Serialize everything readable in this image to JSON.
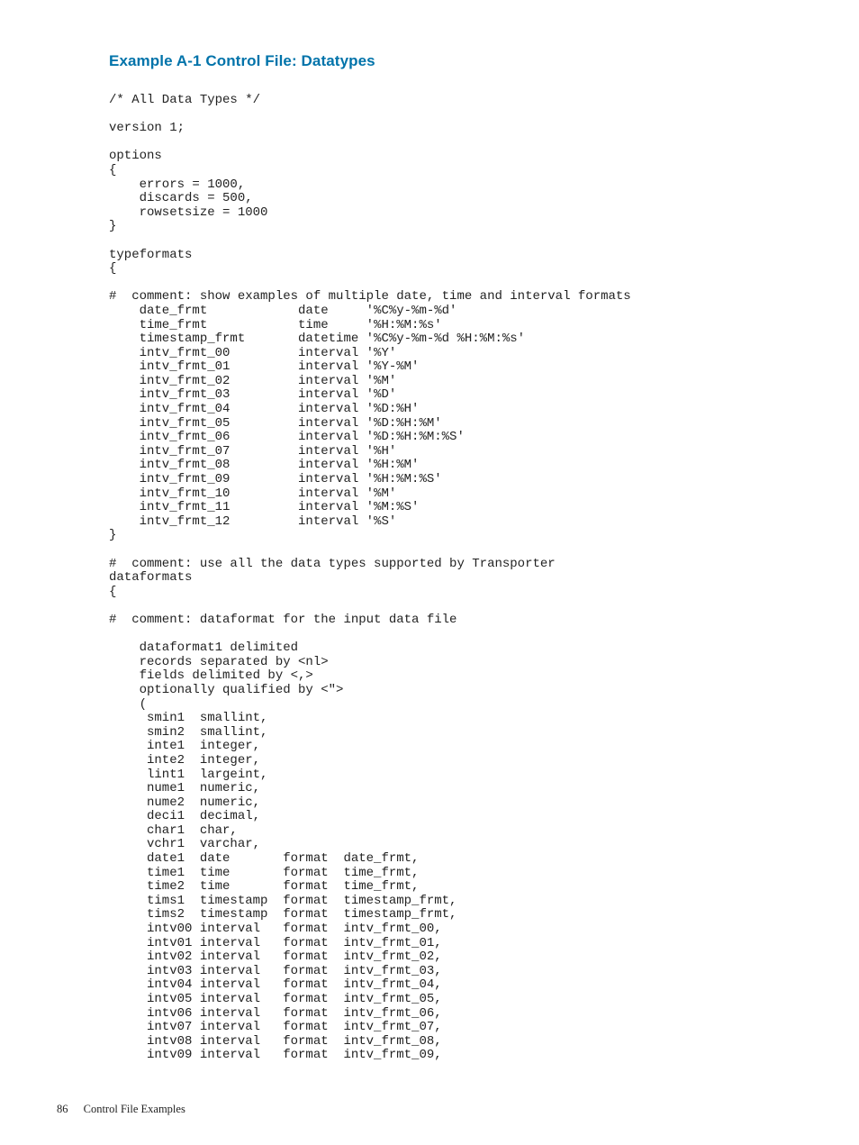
{
  "heading": "Example A-1 Control File: Datatypes",
  "code": "/* All Data Types */\n\nversion 1;\n\noptions\n{\n    errors = 1000,\n    discards = 500,\n    rowsetsize = 1000\n}\n\ntypeformats\n{\n\n#  comment: show examples of multiple date, time and interval formats\n    date_frmt            date     '%C%y-%m-%d'               \n    time_frmt            time     '%H:%M:%s'                 \n    timestamp_frmt       datetime '%C%y-%m-%d %H:%M:%s'\n    intv_frmt_00         interval '%Y'\n    intv_frmt_01         interval '%Y-%M'\n    intv_frmt_02         interval '%M'\n    intv_frmt_03         interval '%D'\n    intv_frmt_04         interval '%D:%H'\n    intv_frmt_05         interval '%D:%H:%M'\n    intv_frmt_06         interval '%D:%H:%M:%S'\n    intv_frmt_07         interval '%H'\n    intv_frmt_08         interval '%H:%M'\n    intv_frmt_09         interval '%H:%M:%S'\n    intv_frmt_10         interval '%M'\n    intv_frmt_11         interval '%M:%S'\n    intv_frmt_12         interval '%S'\n}\n\n#  comment: use all the data types supported by Transporter\ndataformats\n{\n\n#  comment: dataformat for the input data file\n\n    dataformat1 delimited\n    records separated by <nl>\n    fields delimited by <,>\n    optionally qualified by <\">\n    (\n     smin1  smallint, \n     smin2  smallint, \n     inte1  integer, \n     inte2  integer, \n     lint1  largeint, \n     nume1  numeric, \n     nume2  numeric, \n     deci1  decimal, \n     char1  char,\n     vchr1  varchar,\n     date1  date       format  date_frmt,\n     time1  time       format  time_frmt,\n     time2  time       format  time_frmt,\n     tims1  timestamp  format  timestamp_frmt,\n     tims2  timestamp  format  timestamp_frmt,\n     intv00 interval   format  intv_frmt_00,\n     intv01 interval   format  intv_frmt_01,\n     intv02 interval   format  intv_frmt_02,\n     intv03 interval   format  intv_frmt_03,\n     intv04 interval   format  intv_frmt_04,\n     intv05 interval   format  intv_frmt_05,\n     intv06 interval   format  intv_frmt_06,\n     intv07 interval   format  intv_frmt_07,\n     intv08 interval   format  intv_frmt_08,\n     intv09 interval   format  intv_frmt_09,",
  "footer": {
    "page_number": "86",
    "section_title": "Control File Examples"
  }
}
